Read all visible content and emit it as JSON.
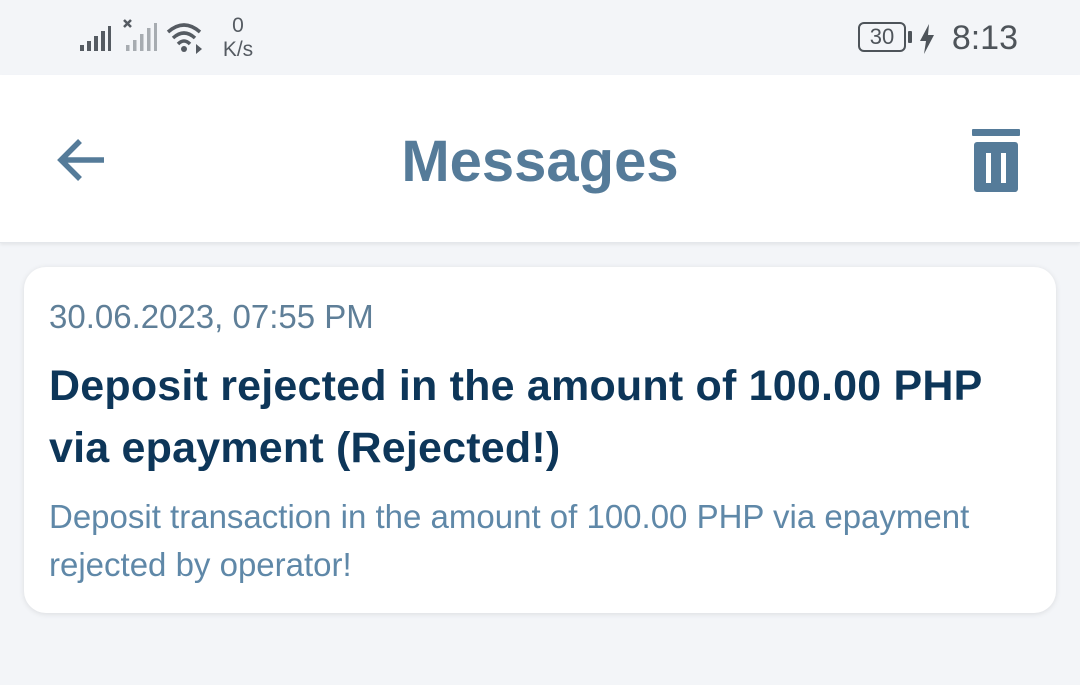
{
  "status_bar": {
    "network_speed_value": "0",
    "network_speed_unit": "K/s",
    "battery_level": "30",
    "time": "8:13",
    "icons": [
      "signal-icon",
      "signal-no-sim-icon",
      "wifi-icon",
      "charging-bolt-icon"
    ]
  },
  "header": {
    "title": "Messages",
    "back_icon": "arrow-left-icon",
    "delete_icon": "trash-icon",
    "accent_color": "#557b99"
  },
  "messages": [
    {
      "date": "30.06.2023, 07:55 PM",
      "title": "Deposit rejected in the amount of 100.00 PHP via epayment (Rejected!)",
      "body": "Deposit transaction in the amount of 100.00 PHP via epayment rejected by operator!"
    }
  ],
  "colors": {
    "background": "#f3f5f8",
    "card": "#ffffff",
    "message_title": "#0d3659",
    "message_meta": "#5f7f98"
  }
}
